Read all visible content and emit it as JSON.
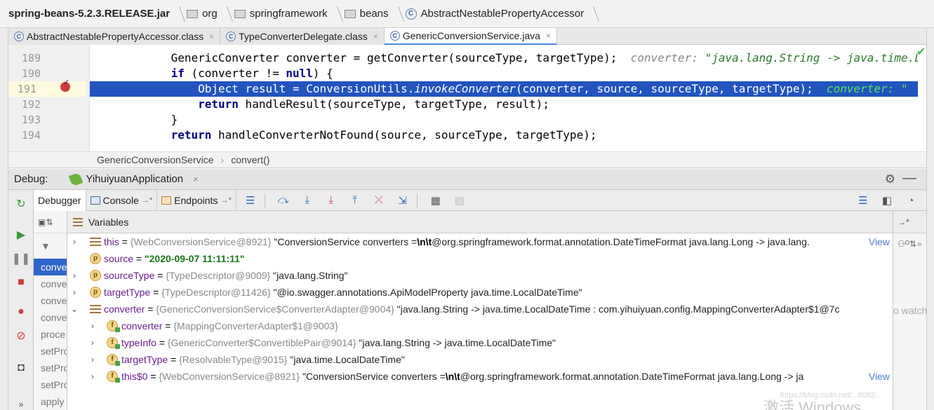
{
  "navbar": {
    "crumbs": [
      "spring-beans-5.2.3.RELEASE.jar",
      "org",
      "springframework",
      "beans",
      "AbstractNestablePropertyAccessor"
    ]
  },
  "tabs": [
    {
      "label": "AbstractNestablePropertyAccessor.class",
      "close": "×"
    },
    {
      "label": "TypeConverterDelegate.class",
      "close": "×"
    },
    {
      "label": "GenericConversionService.java",
      "close": "×"
    }
  ],
  "code": {
    "lines": [
      {
        "num": "189",
        "text_a": "            GenericConverter converter = getConverter(sourceType, targetType);  ",
        "hint": "converter: ",
        "val": "\"java.lang.String -> java.time.LocalDateTime\""
      },
      {
        "num": "190",
        "kw": "            if",
        "text_a": " (converter != ",
        "kw2": "null",
        "text_b": ") {"
      },
      {
        "num": "191",
        "text_a": "                Object result = ConversionUtils.",
        "italic": "invokeConverter",
        "text_b": "(converter, source, sourceType, targetType);  ",
        "hint": "converter: \""
      },
      {
        "num": "192",
        "kw": "                return",
        "text_a": " handleResult(sourceType, targetType, result);"
      },
      {
        "num": "193",
        "text_a": "            }"
      },
      {
        "num": "194",
        "kw": "            return",
        "text_a": " handleConverterNotFound(source, sourceType, targetType);"
      }
    ]
  },
  "editcrumb": {
    "cls": "GenericConversionService",
    "method": "convert()"
  },
  "debug": {
    "label": "Debug:",
    "session": "YihuiyuanApplication",
    "tabs": [
      "Debugger",
      "Console",
      "Endpoints"
    ]
  },
  "frames": [
    "conve",
    "conve",
    "conve",
    "conve",
    "proce",
    "setPro",
    "setPro",
    "setPro",
    "apply"
  ],
  "variables": {
    "title": "Variables",
    "rows": [
      {
        "name": "this",
        "eq": " = ",
        "type": "{WebConversionService@8921}",
        "val": " \"ConversionService converters =",
        "bold": "\\n\\t",
        "tail": "@org.springframework.format.annotation.DateTimeFormat java.lang.Long -> java.lang.",
        "view": "View"
      },
      {
        "name": "source",
        "eq": " = ",
        "str": "\"2020-09-07 11:11:11\""
      },
      {
        "name": "sourceType",
        "eq": " = ",
        "type": "{TypeDescriptor@9009}",
        "val": " \"java.lang.String\""
      },
      {
        "name": "targetType",
        "eq": " = ",
        "type": "{TypeDescriptor@11426}",
        "val": " \"@io.swagger.annotations.ApiModelProperty java.time.LocalDateTime\""
      },
      {
        "name": "converter",
        "eq": " = ",
        "type": "{GenericConversionService$ConverterAdapter@9004}",
        "val": " \"java.lang.String -> java.time.LocalDateTime : com.yihuiyuan.config.MappingConverterAdapter$1@7c"
      },
      {
        "name": "converter",
        "eq": " = ",
        "type": "{MappingConverterAdapter$1@9003}"
      },
      {
        "name": "typeInfo",
        "eq": " = ",
        "type": "{GenericConverter$ConvertiblePair@9014}",
        "val": " \"java.lang.String -> java.time.LocalDateTime\""
      },
      {
        "name": "targetType",
        "eq": " = ",
        "type": "{ResolvableType@9015}",
        "val": " \"java.time.LocalDateTime\""
      },
      {
        "name": "this$0",
        "eq": " = ",
        "type": "{WebConversionService@8921}",
        "val": " \"ConversionService converters =",
        "bold": "\\n\\t",
        "tail": "@org.springframework.format.annotation.DateTimeFormat java.lang.Long -> ja",
        "view": "View"
      }
    ]
  },
  "watches": {
    "hint": "o watch"
  },
  "watermark": {
    "text": "激活 Windows",
    "url": "https://blog.csdn.net/...8082..."
  }
}
